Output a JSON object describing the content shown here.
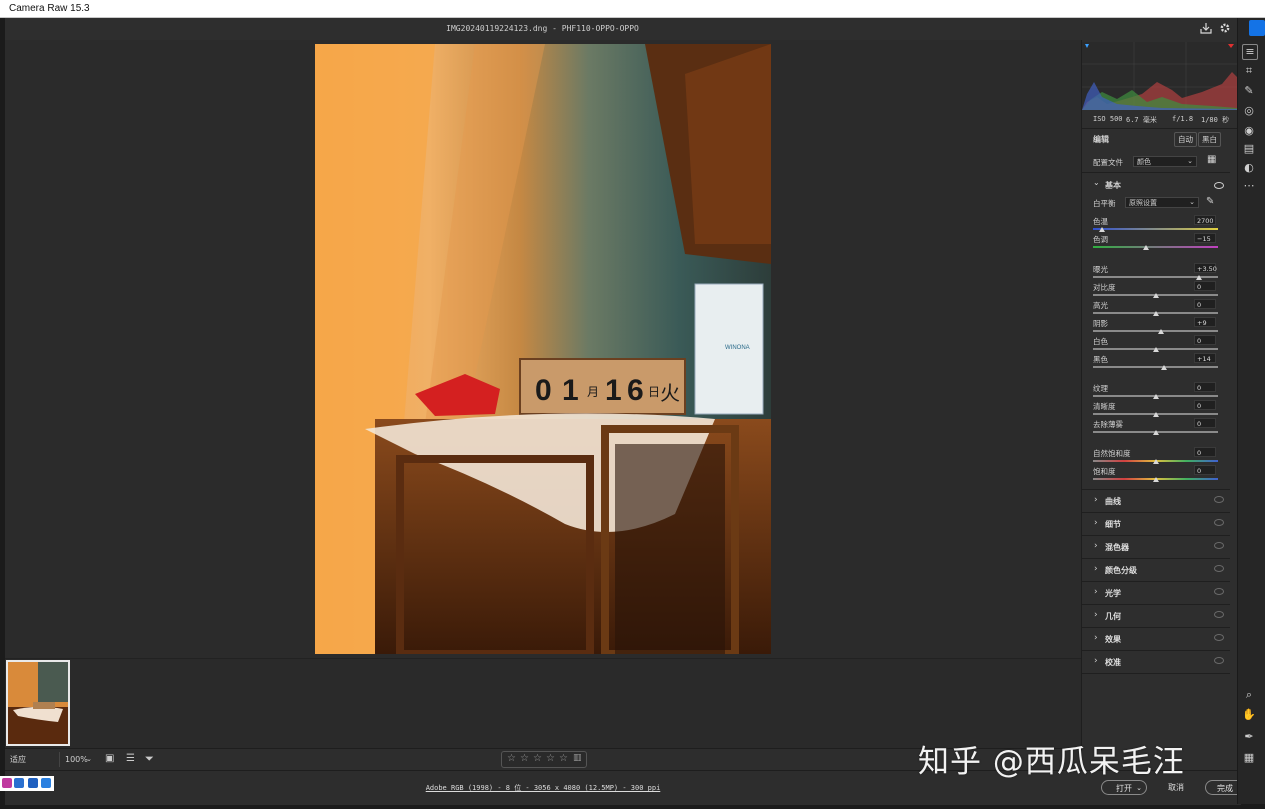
{
  "window": {
    "title": "Camera Raw 15.3"
  },
  "file": {
    "name": "IMG20240119224123.dng -  PHF110-OPPO-OPPO"
  },
  "exif": {
    "iso": "ISO 500",
    "focal": "6.7 毫米",
    "aperture": "f/1.8",
    "shutter": "1/80 秒"
  },
  "edit": {
    "title": "编辑",
    "auto": "自动",
    "bw": "黑白",
    "profile_label": "配置文件",
    "profile_value": "颜色",
    "basic": {
      "title": "基本",
      "wb_label": "白平衡",
      "wb_value": "原照设置",
      "temp_label": "色温",
      "temp_value": "2700",
      "tint_label": "色调",
      "tint_value": "−15",
      "exposure_label": "曝光",
      "exposure_value": "+3.50",
      "contrast_label": "对比度",
      "contrast_value": "0",
      "highlights_label": "高光",
      "highlights_value": "0",
      "shadows_label": "阴影",
      "shadows_value": "+9",
      "whites_label": "白色",
      "whites_value": "0",
      "blacks_label": "黑色",
      "blacks_value": "+14",
      "texture_label": "纹理",
      "texture_value": "0",
      "clarity_label": "清晰度",
      "clarity_value": "0",
      "dehaze_label": "去除薄雾",
      "dehaze_value": "0",
      "vibrance_label": "自然饱和度",
      "vibrance_value": "0",
      "saturation_label": "饱和度",
      "saturation_value": "0"
    },
    "sections": [
      "曲线",
      "细节",
      "混色器",
      "颜色分级",
      "光学",
      "几何",
      "效果",
      "校准"
    ]
  },
  "toolbar": {
    "fit": "适应 (25.8%)",
    "zoom": "100%"
  },
  "status": {
    "info": "Adobe RGB (1998) - 8 位 - 3056 x 4080 (12.5MP) - 300 ppi"
  },
  "buttons": {
    "open": "打开",
    "cancel": "取消",
    "done": "完成"
  },
  "rating": {
    "stars": 5
  },
  "watermark": "知乎 @西瓜呆毛汪",
  "photo": {
    "calendar": [
      "0",
      "1",
      "月",
      "1",
      "6",
      "日",
      "火"
    ],
    "box_label": "WINONA"
  },
  "colors": {
    "accent": "#1473e6",
    "panel": "#2e2e2e",
    "canvas": "#2b2b2b"
  },
  "icons": [
    "save-icon",
    "gear-icon",
    "edit-sliders-icon",
    "crop-icon",
    "heal-icon",
    "mask-icon",
    "redeye-icon",
    "snapshot-icon",
    "presets-icon",
    "more-icon",
    "zoom-icon",
    "hand-icon",
    "color-sampler-icon",
    "grid-icon"
  ]
}
